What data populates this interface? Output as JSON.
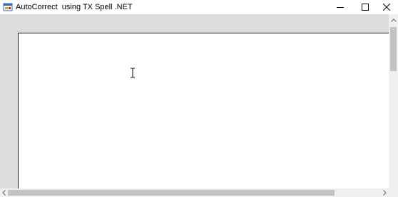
{
  "window": {
    "title": "AutoCorrect  using TX Spell .NET",
    "app_icon": "application-icon",
    "controls": {
      "minimize": "minimize-icon",
      "maximize": "maximize-icon",
      "close": "close-icon"
    }
  },
  "editor": {
    "cursor": "text-cursor-icon",
    "content": ""
  },
  "scrollbars": {
    "vertical": {
      "up": "chevron-up-icon"
    },
    "horizontal": {
      "left": "chevron-left-icon",
      "right": "chevron-right-icon"
    }
  }
}
